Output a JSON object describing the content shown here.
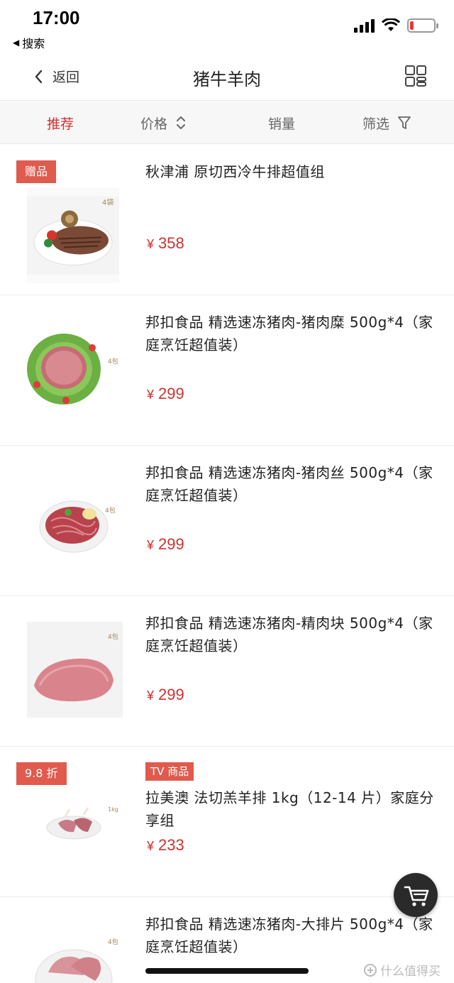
{
  "status_bar": {
    "time": "17:00",
    "back_app": "搜索"
  },
  "nav": {
    "back_label": "返回",
    "title": "猪牛羊肉",
    "grid_icon": "grid-view-icon"
  },
  "sort_bar": {
    "recommend": "推荐",
    "price": "价格",
    "sales": "销量",
    "filter": "筛选",
    "active_color": "#d0312d"
  },
  "products": [
    {
      "badge": "赠品",
      "tv_tag": "",
      "title": "秋津浦 原切西冷牛排超值组",
      "price": "358",
      "thumb_label": "4袋"
    },
    {
      "badge": "",
      "tv_tag": "",
      "title": "邦扣食品 精选速冻猪肉-猪肉糜 500g*4（家庭烹饪超值装）",
      "price": "299",
      "thumb_label": "4包"
    },
    {
      "badge": "",
      "tv_tag": "",
      "title": "邦扣食品 精选速冻猪肉-猪肉丝 500g*4（家庭烹饪超值装）",
      "price": "299",
      "thumb_label": "4包"
    },
    {
      "badge": "",
      "tv_tag": "",
      "title": "邦扣食品 精选速冻猪肉-精肉块 500g*4（家庭烹饪超值装）",
      "price": "299",
      "thumb_label": "4包"
    },
    {
      "badge": "9.8 折",
      "tv_tag": "TV 商品",
      "title": "拉美澳 法切羔羊排 1kg（12-14 片）家庭分享组",
      "price": "233",
      "thumb_label": "1kg"
    },
    {
      "badge": "",
      "tv_tag": "",
      "title": "邦扣食品 精选速冻猪肉-大排片 500g*4（家庭烹饪超值装）",
      "price": "",
      "thumb_label": "4包"
    }
  ],
  "currency": "¥",
  "watermark": "什么值得买",
  "colors": {
    "price": "#d0312d",
    "badge": "#e05a4d"
  }
}
